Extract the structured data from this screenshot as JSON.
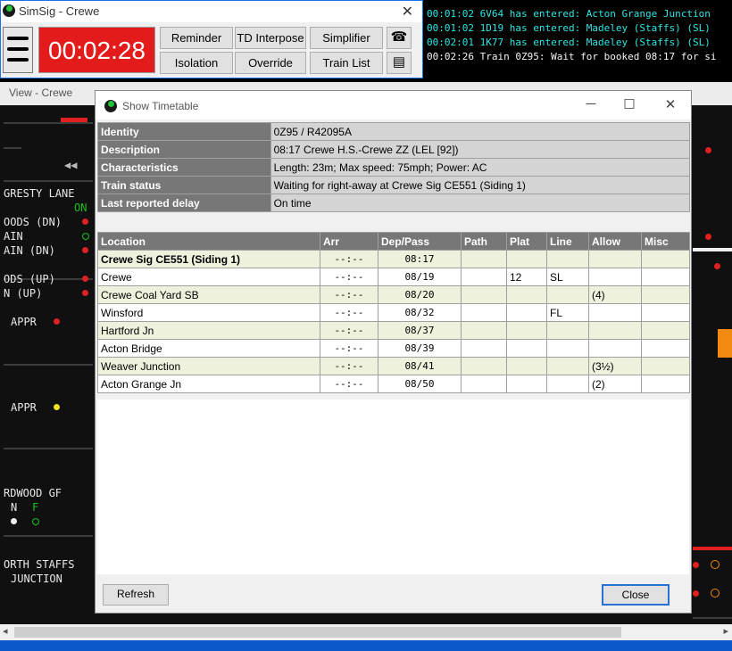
{
  "main_window": {
    "title": "SimSig - Crewe",
    "clock": "00:02:28",
    "buttons": {
      "reminder": "Reminder",
      "td_interpose": "TD Interpose",
      "simplifier": "Simplifier",
      "isolation": "Isolation",
      "override": "Override",
      "train_list": "Train List"
    },
    "icons": {
      "phone": "phone-icon",
      "printer": "printer-icon"
    }
  },
  "message_log": [
    "00:01:02 6V64 has entered: Acton Grange Junction",
    "00:01:02 1D19 has entered: Madeley (Staffs) (SL)",
    "00:02:01 1K77 has entered: Madeley (Staffs) (SL)",
    "00:02:26 Train 0Z95: Wait for booked 08:17 for si"
  ],
  "view": {
    "title": "View - Crewe",
    "labels": [
      "GRESTY LANE",
      "ON",
      "OODS (DN)",
      "AIN",
      "AIN (DN)",
      "ODS (UP)",
      "N (UP)",
      "APPR",
      "APPR",
      "RDWOOD GF",
      "N",
      "F",
      "ORTH STAFFS",
      "JUNCTION"
    ]
  },
  "dialog": {
    "title": "Show Timetable",
    "info": [
      {
        "label": "Identity",
        "value": "0Z95 / R42095A"
      },
      {
        "label": "Description",
        "value": "08:17 Crewe H.S.-Crewe ZZ (LEL [92])"
      },
      {
        "label": "Characteristics",
        "value": "Length: 23m; Max speed: 75mph; Power: AC"
      },
      {
        "label": "Train status",
        "value": "Waiting for right-away at Crewe Sig CE551 (Siding 1)"
      },
      {
        "label": "Last reported delay",
        "value": "On time"
      }
    ],
    "columns": [
      "Location",
      "Arr",
      "Dep/Pass",
      "Path",
      "Plat",
      "Line",
      "Allow",
      "Misc"
    ],
    "rows": [
      {
        "location": "Crewe Sig CE551 (Siding 1)",
        "arr": "--:--",
        "dep": "08:17",
        "path": "",
        "plat": "",
        "line": "",
        "allow": "",
        "misc": ""
      },
      {
        "location": "Crewe",
        "arr": "--:--",
        "dep": "08/19",
        "path": "",
        "plat": "12",
        "line": "SL",
        "allow": "",
        "misc": ""
      },
      {
        "location": "Crewe Coal Yard SB",
        "arr": "--:--",
        "dep": "08/20",
        "path": "",
        "plat": "",
        "line": "",
        "allow": "(4)",
        "misc": ""
      },
      {
        "location": "Winsford",
        "arr": "--:--",
        "dep": "08/32",
        "path": "",
        "plat": "",
        "line": "FL",
        "allow": "",
        "misc": ""
      },
      {
        "location": "Hartford Jn",
        "arr": "--:--",
        "dep": "08/37",
        "path": "",
        "plat": "",
        "line": "",
        "allow": "",
        "misc": ""
      },
      {
        "location": "Acton Bridge",
        "arr": "--:--",
        "dep": "08/39",
        "path": "",
        "plat": "",
        "line": "",
        "allow": "",
        "misc": ""
      },
      {
        "location": "Weaver Junction",
        "arr": "--:--",
        "dep": "08/41",
        "path": "",
        "plat": "",
        "line": "",
        "allow": "(3½)",
        "misc": ""
      },
      {
        "location": "Acton Grange Jn",
        "arr": "--:--",
        "dep": "08/50",
        "path": "",
        "plat": "",
        "line": "",
        "allow": "(2)",
        "misc": ""
      }
    ],
    "refresh_label": "Refresh",
    "close_label": "Close"
  }
}
